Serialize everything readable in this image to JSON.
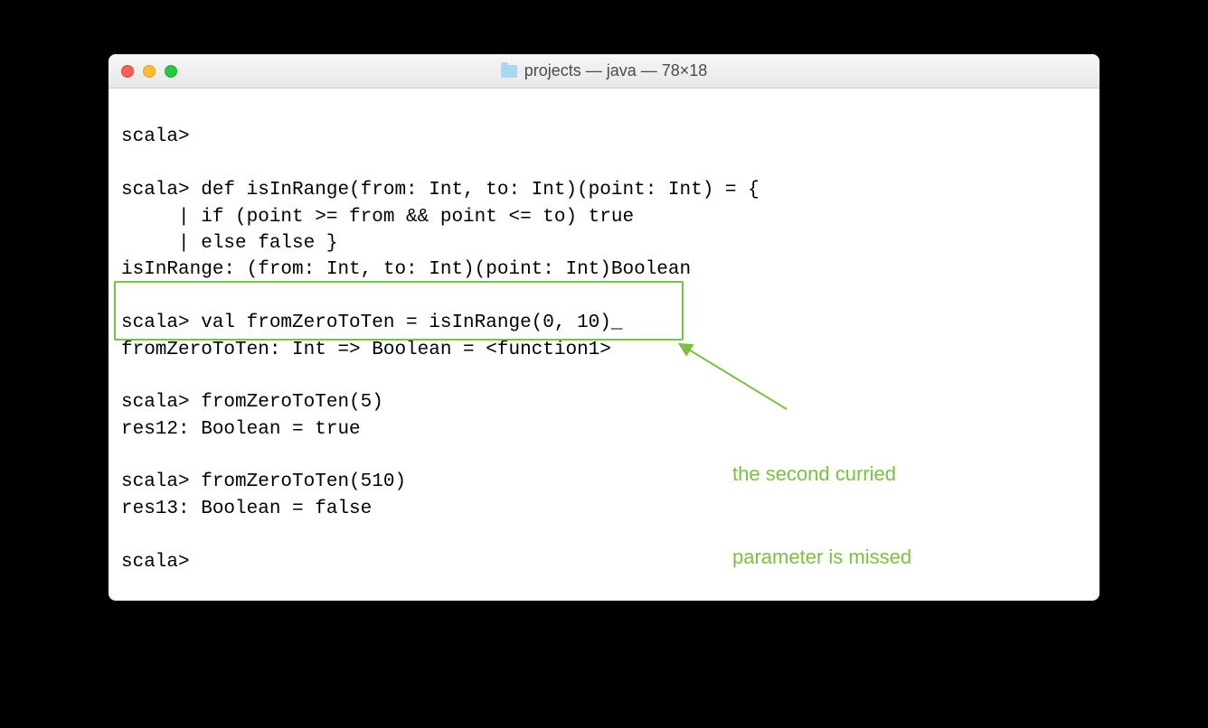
{
  "window": {
    "title": "projects — java — 78×18"
  },
  "terminal": {
    "lines": {
      "l0": "scala>",
      "l1": "",
      "l2": "scala> def isInRange(from: Int, to: Int)(point: Int) = {",
      "l3": "     | if (point >= from && point <= to) true",
      "l4": "     | else false }",
      "l5": "isInRange: (from: Int, to: Int)(point: Int)Boolean",
      "l6": "",
      "l7": "scala> val fromZeroToTen = isInRange(0, 10)_",
      "l8": "fromZeroToTen: Int => Boolean = <function1>",
      "l9": "",
      "l10": "scala> fromZeroToTen(5)",
      "l11": "res12: Boolean = true",
      "l12": "",
      "l13": "scala> fromZeroToTen(510)",
      "l14": "res13: Boolean = false",
      "l15": "",
      "l16": "scala>"
    }
  },
  "annotation": {
    "line1": "the second curried",
    "line2": "parameter is missed"
  },
  "colors": {
    "highlight": "#7ac142",
    "annotation_text": "#7ac142"
  }
}
